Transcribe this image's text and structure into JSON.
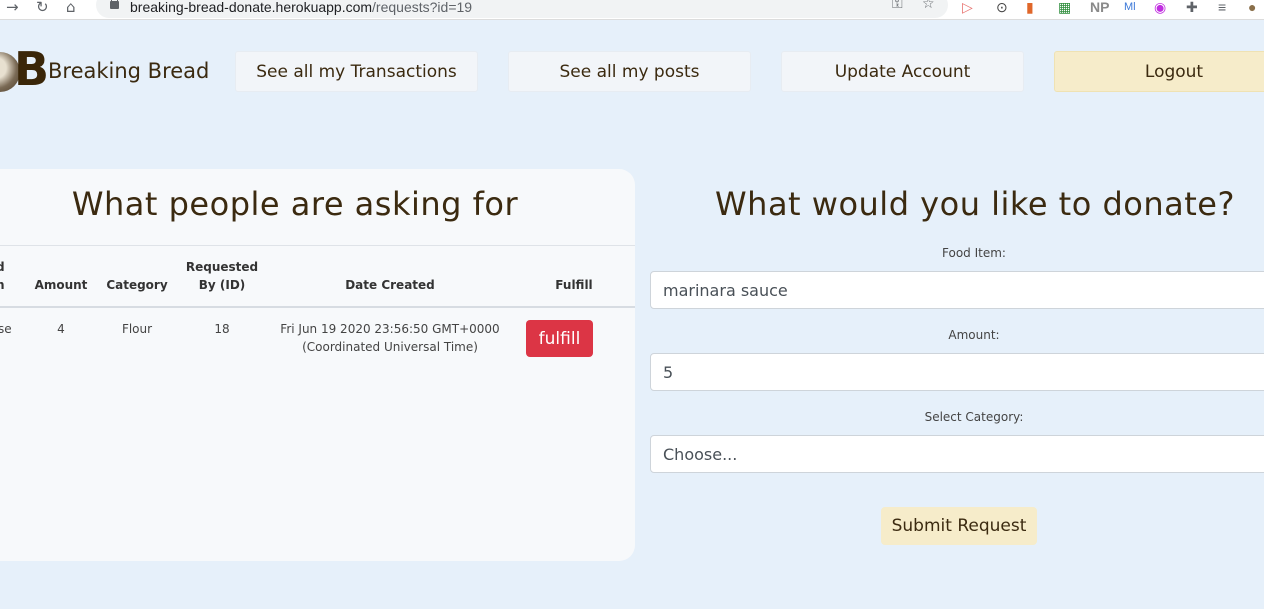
{
  "browser": {
    "url_host": "breaking-bread-donate.herokuapp.com",
    "url_path": "/requests?id=19",
    "extensions": [
      "NP",
      "Ml"
    ]
  },
  "header": {
    "brand": "Breaking Bread",
    "nav": {
      "transactions": "See all my Transactions",
      "posts": "See all my posts",
      "update": "Update Account",
      "logout": "Logout"
    }
  },
  "requests": {
    "title": "What people are asking for",
    "columns": {
      "food_partial_top": "d",
      "food_partial_bottom": "n",
      "amount": "Amount",
      "category": "Category",
      "requested_line1": "Requested",
      "requested_line2": "By (ID)",
      "date": "Date Created",
      "fulfill": "Fulfill"
    },
    "rows": [
      {
        "food_partial": "se",
        "amount": "4",
        "category": "Flour",
        "requested_by": "18",
        "date_line1": "Fri Jun 19 2020 23:56:50 GMT+0000",
        "date_line2": "(Coordinated Universal Time)",
        "action": "fulfill"
      }
    ]
  },
  "donate": {
    "title": "What would you like to donate?",
    "food_label": "Food Item:",
    "food_value": "marinara sauce",
    "amount_label": "Amount:",
    "amount_value": "5",
    "category_label": "Select Category:",
    "category_value": "Choose...",
    "submit": "Submit Request"
  },
  "colors": {
    "page_bg": "#e6f0fa",
    "brand_text": "#3b2a10",
    "logout_bg": "#f6ecca",
    "fulfill_bg": "#dc3545"
  }
}
